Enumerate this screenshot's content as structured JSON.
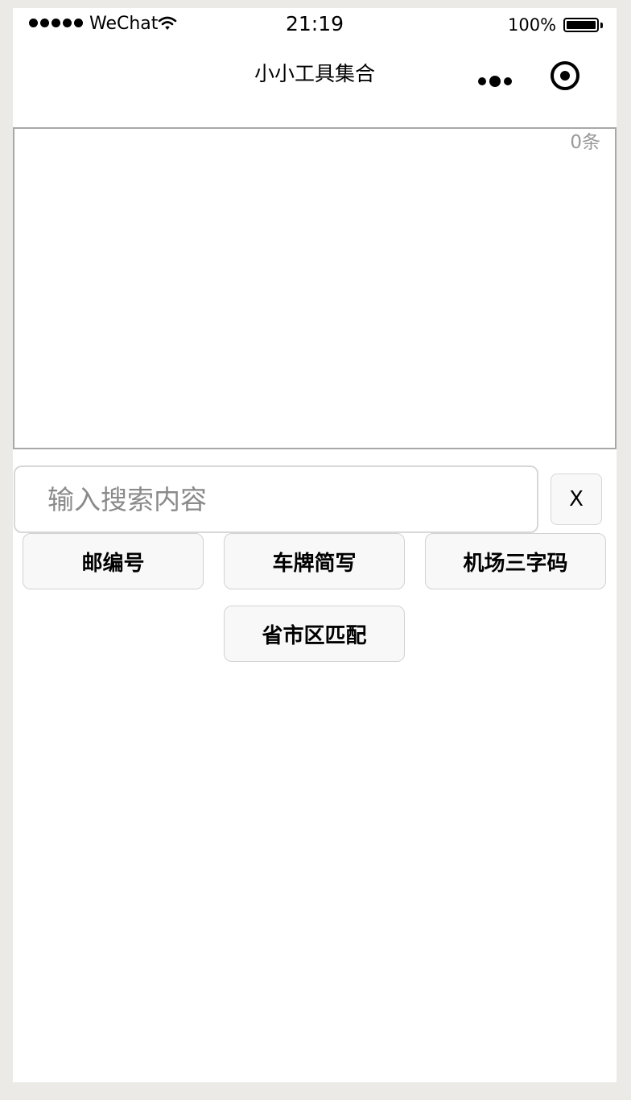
{
  "status_bar": {
    "carrier": "WeChat",
    "time": "21:19",
    "battery": "100%",
    "battery_level": 1.0,
    "icons": [
      "signal-dots",
      "wifi-icon",
      "battery-icon"
    ]
  },
  "nav_bar": {
    "title": "小小工具集合",
    "icons": [
      "more-icon",
      "target-icon"
    ]
  },
  "results": {
    "count_label": "0条"
  },
  "search": {
    "placeholder": "输入搜索内容",
    "value": "",
    "clear_label": "X"
  },
  "tools": {
    "items": [
      {
        "label": "邮编号"
      },
      {
        "label": "车牌简写"
      },
      {
        "label": "机场三字码"
      },
      {
        "label": "省市区匹配"
      }
    ]
  },
  "colors": {
    "page_background": "#eceae6",
    "screen_background": "#ffffff",
    "button_background": "#f8f8f8",
    "border": "#a8a8a8",
    "muted_text": "#999999"
  }
}
